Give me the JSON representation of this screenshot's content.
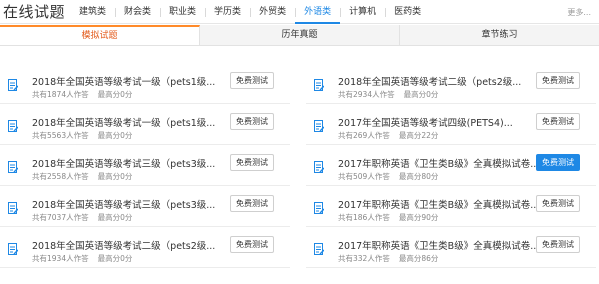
{
  "header": {
    "title": "在线试题",
    "categories": [
      {
        "label": "建筑类",
        "active": false
      },
      {
        "label": "财会类",
        "active": false
      },
      {
        "label": "职业类",
        "active": false
      },
      {
        "label": "学历类",
        "active": false
      },
      {
        "label": "外贸类",
        "active": false
      },
      {
        "label": "外语类",
        "active": true
      },
      {
        "label": "计算机",
        "active": false
      },
      {
        "label": "医药类",
        "active": false
      }
    ],
    "more": "更多..."
  },
  "tabs": [
    {
      "label": "模拟试题",
      "active": true
    },
    {
      "label": "历年真题",
      "active": false
    },
    {
      "label": "章节练习",
      "active": false
    }
  ],
  "left_list": [
    {
      "name": "2018年全国英语等级考试一级（pets1级...",
      "users": "共有1874人作答",
      "score": "最高分0分",
      "button": "免费测试",
      "highlight": false
    },
    {
      "name": "2018年全国英语等级考试一级（pets1级...",
      "users": "共有5563人作答",
      "score": "最高分0分",
      "button": "免费测试",
      "highlight": false
    },
    {
      "name": "2018年全国英语等级考试三级（pets3级...",
      "users": "共有2558人作答",
      "score": "最高分0分",
      "button": "免费测试",
      "highlight": false
    },
    {
      "name": "2018年全国英语等级考试三级（pets3级...",
      "users": "共有7037人作答",
      "score": "最高分0分",
      "button": "免费测试",
      "highlight": false
    },
    {
      "name": "2018年全国英语等级考试二级（pets2级...",
      "users": "共有1934人作答",
      "score": "最高分0分",
      "button": "免费测试",
      "highlight": false
    }
  ],
  "right_list": [
    {
      "name": "2018年全国英语等级考试二级（pets2级...",
      "users": "共有2934人作答",
      "score": "最高分0分",
      "button": "免费测试",
      "highlight": false
    },
    {
      "name": "2017年全国英语等级考试四级(PETS4)...",
      "users": "共有269人作答",
      "score": "最高分22分",
      "button": "免费测试",
      "highlight": false
    },
    {
      "name": "2017年职称英语《卫生类B级》全真模拟试卷...",
      "users": "共有509人作答",
      "score": "最高分80分",
      "button": "免费测试",
      "highlight": true
    },
    {
      "name": "2017年职称英语《卫生类B级》全真模拟试卷...",
      "users": "共有186人作答",
      "score": "最高分90分",
      "button": "免费测试",
      "highlight": false
    },
    {
      "name": "2017年职称英语《卫生类B级》全真模拟试卷...",
      "users": "共有332人作答",
      "score": "最高分86分",
      "button": "免费测试",
      "highlight": false
    }
  ],
  "icons": {
    "item": "document-edit-icon"
  },
  "colors": {
    "accent": "#1e88e5",
    "tab_active": "#e35b1c",
    "tab_active_border": "#ff8a2a"
  }
}
